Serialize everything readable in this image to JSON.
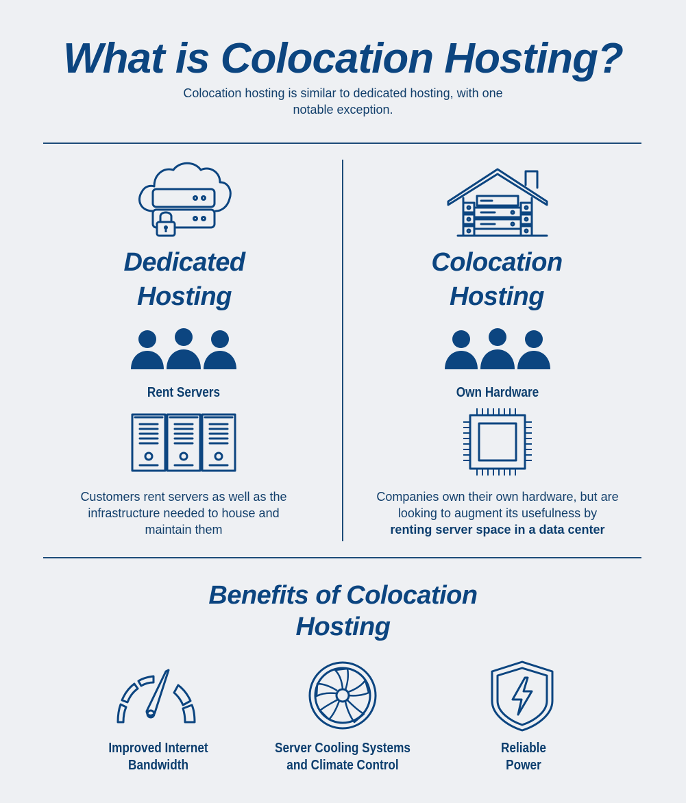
{
  "header": {
    "title": "What is Colocation Hosting?",
    "subtitle": "Colocation hosting is similar to dedicated hosting, with one notable exception."
  },
  "dedicated": {
    "heading_line1": "Dedicated",
    "heading_line2": "Hosting",
    "label": "Rent Servers",
    "description": "Customers rent servers as well as the infrastructure needed to house and maintain them",
    "icons": [
      "cloud-server-lock-icon",
      "users-icon",
      "server-rack-icon"
    ]
  },
  "colocation": {
    "heading_line1": "Colocation",
    "heading_line2": "Hosting",
    "label": "Own Hardware",
    "description_plain": "Companies own their own hardware, but are looking to augment its usefulness by",
    "description_bold": "renting server space in a data center",
    "icons": [
      "house-server-icon",
      "users-icon",
      "chip-icon"
    ]
  },
  "benefits": {
    "heading_line1": "Benefits of Colocation",
    "heading_line2": "Hosting",
    "items": [
      {
        "line1": "Improved Internet",
        "line2": "Bandwidth",
        "icon": "speedometer-icon"
      },
      {
        "line1": "Server Cooling Systems",
        "line2": "and Climate Control",
        "icon": "fan-icon"
      },
      {
        "line1": "Reliable",
        "line2": "Power",
        "icon": "shield-bolt-icon"
      }
    ]
  },
  "colors": {
    "primary": "#0c4580",
    "background": "#eef0f3"
  }
}
